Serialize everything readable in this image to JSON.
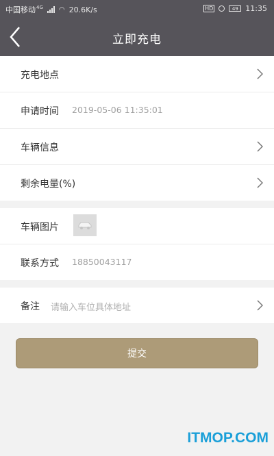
{
  "status_bar": {
    "carrier": "中国移动",
    "network": "4G",
    "speed": "20.6K/s",
    "hd": "HD",
    "battery": "49",
    "time": "11:35"
  },
  "header": {
    "title": "立即充电"
  },
  "form": {
    "charge_location_label": "充电地点",
    "apply_time_label": "申请时间",
    "apply_time_value": "2019-05-06 11:35:01",
    "vehicle_info_label": "车辆信息",
    "remaining_power_label": "剩余电量(%)",
    "vehicle_photo_label": "车辆图片",
    "contact_label": "联系方式",
    "contact_value": "18850043117",
    "remark_label": "备注",
    "remark_placeholder": "请输入车位具体地址"
  },
  "actions": {
    "submit_label": "提交"
  },
  "watermark": "ITMOP.COM"
}
